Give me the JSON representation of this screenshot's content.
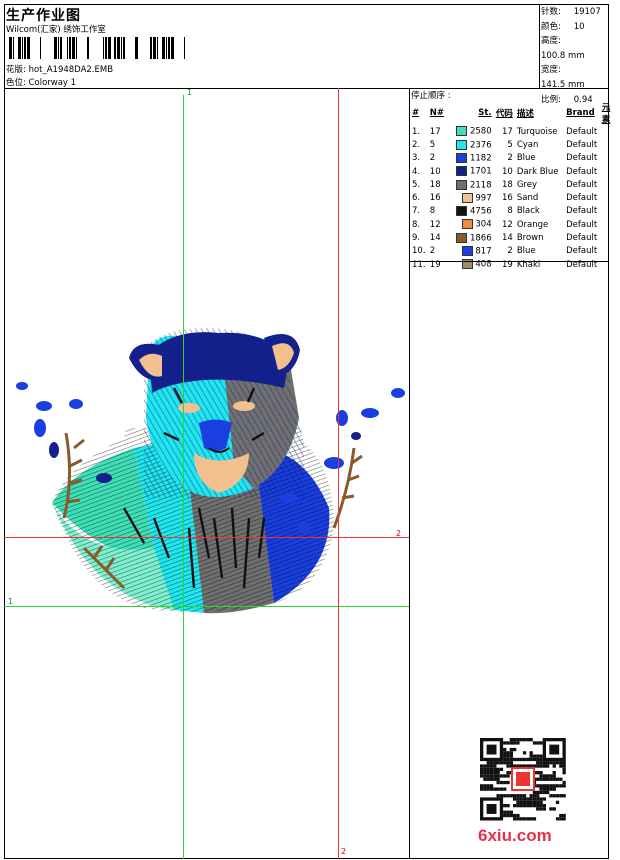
{
  "header": {
    "title": "生产作业图",
    "subtitle": "Wilcom(汇家) 绣饰工作室",
    "design_line": "花版: hot_A1948DA2.EMB",
    "colorway_line": "色位: Colorway 1"
  },
  "stats": [
    {
      "key": "针数:",
      "value": "19107"
    },
    {
      "key": "颜色:",
      "value": "10"
    },
    {
      "key": "高度:",
      "value": "100.8 mm"
    },
    {
      "key": "宽度:",
      "value": "141.5 mm"
    },
    {
      "key": "比例:",
      "value": "0.94"
    }
  ],
  "stop_sequence_label": "停止顺序 :",
  "columns": [
    "#",
    "N#",
    "St.",
    "代码",
    "描述",
    "Brand",
    "元素"
  ],
  "colors": [
    {
      "n": "1.",
      "needle": "17",
      "color": "#3fe0b8",
      "stitches": "2580",
      "code": "17",
      "desc": "Turquoise",
      "brand": "Default"
    },
    {
      "n": "2.",
      "needle": "5",
      "color": "#22e6ee",
      "stitches": "2376",
      "code": "5",
      "desc": "Cyan",
      "brand": "Default"
    },
    {
      "n": "3.",
      "needle": "2",
      "color": "#1a3fe0",
      "stitches": "1182",
      "code": "2",
      "desc": "Blue",
      "brand": "Default"
    },
    {
      "n": "4.",
      "needle": "10",
      "color": "#14208c",
      "stitches": "1701",
      "code": "10",
      "desc": "Dark Blue",
      "brand": "Default"
    },
    {
      "n": "5.",
      "needle": "18",
      "color": "#707070",
      "stitches": "2118",
      "code": "18",
      "desc": "Grey",
      "brand": "Default"
    },
    {
      "n": "6.",
      "needle": "16",
      "color": "#f2c08e",
      "stitches": "997",
      "code": "16",
      "desc": "Sand",
      "brand": "Default"
    },
    {
      "n": "7.",
      "needle": "8",
      "color": "#111111",
      "stitches": "4756",
      "code": "8",
      "desc": "Black",
      "brand": "Default"
    },
    {
      "n": "8.",
      "needle": "12",
      "color": "#f08a3a",
      "stitches": "304",
      "code": "12",
      "desc": "Orange",
      "brand": "Default"
    },
    {
      "n": "9.",
      "needle": "14",
      "color": "#8a5a2a",
      "stitches": "1866",
      "code": "14",
      "desc": "Brown",
      "brand": "Default"
    },
    {
      "n": "10.",
      "needle": "2",
      "color": "#1a3fe0",
      "stitches": "817",
      "code": "2",
      "desc": "Blue",
      "brand": "Default"
    },
    {
      "n": "11.",
      "needle": "19",
      "color": "#9a8f60",
      "stitches": "408",
      "code": "19",
      "desc": "Khaki",
      "brand": "Default"
    }
  ],
  "guides": {
    "green_v_label": "1",
    "green_h_label": "1",
    "red_v_label": "2",
    "red_h_label": "2"
  },
  "watermark": "6xiu.com"
}
